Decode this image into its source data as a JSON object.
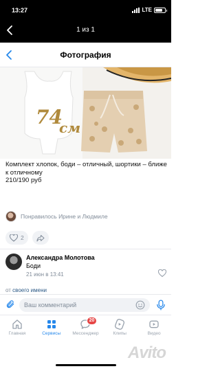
{
  "status_bar": {
    "time": "13:27",
    "network": "LTE"
  },
  "viewer": {
    "counter": "1 из 1"
  },
  "header": {
    "title": "Фотография"
  },
  "photo": {
    "overlay_text": [
      "74",
      "см"
    ]
  },
  "post": {
    "caption": "Комплект хлопок, боди – отличный, шортики – ближе к отличному",
    "price": "210/190 руб",
    "liked_by": "Понравилось Ирине и Людмиле",
    "like_count": "2"
  },
  "comment": {
    "author": "Александра Молотова",
    "text": "Боди",
    "date": "21 июн в 13:41"
  },
  "send_as": {
    "prefix": "от",
    "link": "своего имени"
  },
  "composer": {
    "placeholder": "Ваш комментарий"
  },
  "tabs": [
    {
      "label": "Главная"
    },
    {
      "label": "Сервисы"
    },
    {
      "label": "Мессенджер",
      "badge": "20"
    },
    {
      "label": "Клипы"
    },
    {
      "label": "Видео"
    }
  ],
  "watermark": "Avito",
  "colors": {
    "accent": "#2688eb",
    "badge": "#e64646",
    "secondary_text": "#818c99"
  }
}
